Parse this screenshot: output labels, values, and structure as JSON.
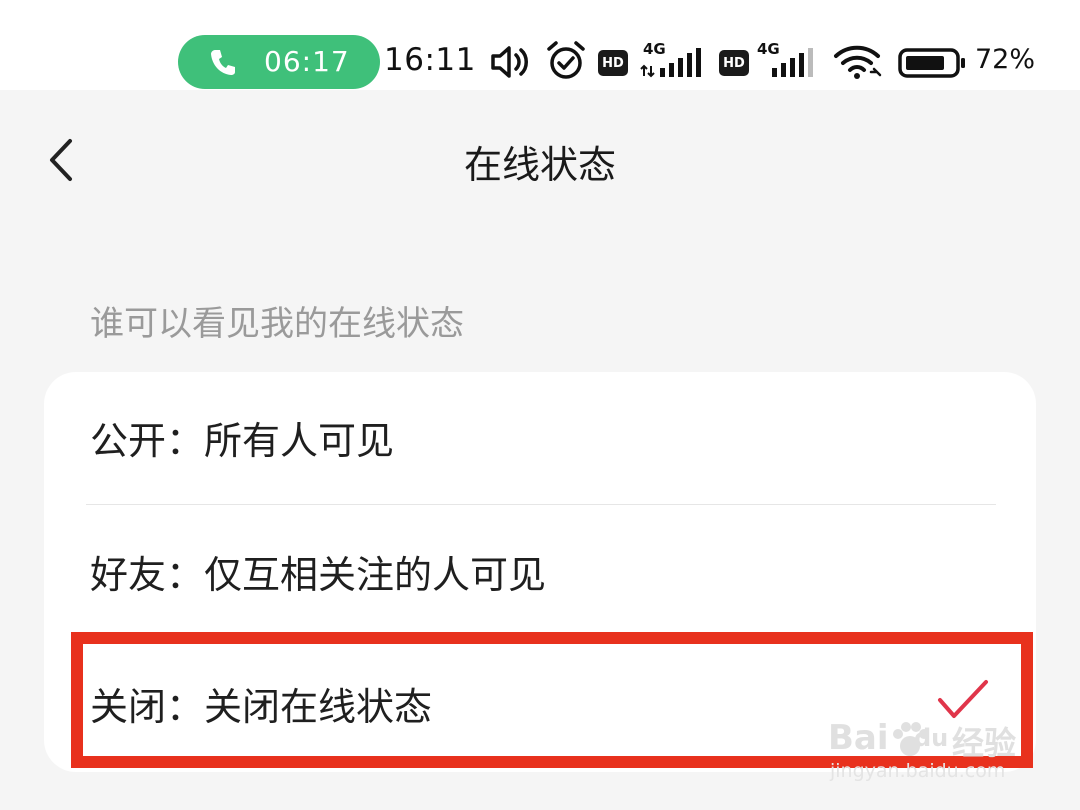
{
  "status_bar": {
    "call_time": "06:17",
    "clock": "16:11",
    "hd_label": "HD",
    "net_label_1": "4G",
    "net_label_2": "4G",
    "battery": "72%"
  },
  "header": {
    "title": "在线状态"
  },
  "section": {
    "title": "谁可以看见我的在线状态"
  },
  "options": [
    {
      "label": "公开：所有人可见",
      "selected": false
    },
    {
      "label": "好友：仅互相关注的人可见",
      "selected": false
    },
    {
      "label": "关闭：关闭在线状态",
      "selected": true
    }
  ],
  "watermark": {
    "brand": "Bai",
    "suffix": "du",
    "cn": "经验",
    "url": "jingyan.baidu.com"
  },
  "colors": {
    "accent_check": "#e0354a",
    "call_green": "#3fc07a",
    "highlight_red": "#e8311d"
  }
}
